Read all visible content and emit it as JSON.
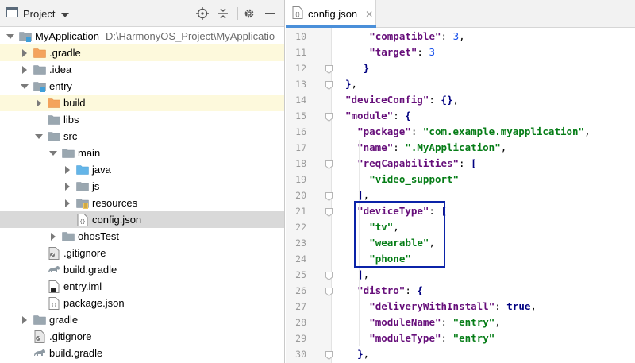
{
  "project_panel": {
    "title": "Project",
    "header_icons": [
      "locate-icon",
      "collapse-icon",
      "gear-icon",
      "hide-icon"
    ],
    "tree": [
      {
        "label": "MyApplication",
        "path": "D:\\HarmonyOS_Project\\MyApplicatio",
        "depth": 0,
        "arrow": "down",
        "icon": "module-folder"
      },
      {
        "label": ".gradle",
        "depth": 1,
        "arrow": "right",
        "icon": "folder-orange",
        "highlight": true
      },
      {
        "label": ".idea",
        "depth": 1,
        "arrow": "right",
        "icon": "folder-gray"
      },
      {
        "label": "entry",
        "depth": 1,
        "arrow": "down",
        "icon": "module-folder"
      },
      {
        "label": "build",
        "depth": 2,
        "arrow": "right",
        "icon": "folder-orange",
        "highlight": true
      },
      {
        "label": "libs",
        "depth": 2,
        "arrow": "none",
        "icon": "folder-gray"
      },
      {
        "label": "src",
        "depth": 2,
        "arrow": "down",
        "icon": "folder-gray"
      },
      {
        "label": "main",
        "depth": 3,
        "arrow": "down",
        "icon": "folder-gray"
      },
      {
        "label": "java",
        "depth": 4,
        "arrow": "right",
        "icon": "folder-blue"
      },
      {
        "label": "js",
        "depth": 4,
        "arrow": "right",
        "icon": "folder-gray"
      },
      {
        "label": "resources",
        "depth": 4,
        "arrow": "right",
        "icon": "folder-resources"
      },
      {
        "label": "config.json",
        "depth": 4,
        "arrow": "none",
        "icon": "json-file",
        "selected": true
      },
      {
        "label": "ohosTest",
        "depth": 3,
        "arrow": "right",
        "icon": "folder-gray"
      },
      {
        "label": ".gitignore",
        "depth": 2,
        "arrow": "none",
        "icon": "gitignore-file"
      },
      {
        "label": "build.gradle",
        "depth": 2,
        "arrow": "none",
        "icon": "gradle-file"
      },
      {
        "label": "entry.iml",
        "depth": 2,
        "arrow": "none",
        "icon": "iml-file"
      },
      {
        "label": "package.json",
        "depth": 2,
        "arrow": "none",
        "icon": "json-file"
      },
      {
        "label": "gradle",
        "depth": 1,
        "arrow": "right",
        "icon": "folder-gray"
      },
      {
        "label": ".gitignore",
        "depth": 1,
        "arrow": "none",
        "icon": "gitignore-file"
      },
      {
        "label": "build.gradle",
        "depth": 1,
        "arrow": "none",
        "icon": "gradle-file"
      }
    ]
  },
  "editor": {
    "tab_label": "config.json",
    "lines": [
      {
        "num": "10",
        "indent": 4,
        "tokens": [
          [
            "k",
            "\"compatible\""
          ],
          [
            "p",
            ": "
          ],
          [
            "n",
            "3"
          ],
          [
            "p",
            ","
          ]
        ]
      },
      {
        "num": "11",
        "indent": 4,
        "tokens": [
          [
            "k",
            "\"target\""
          ],
          [
            "p",
            ": "
          ],
          [
            "n",
            "3"
          ]
        ]
      },
      {
        "num": "12",
        "indent": 3,
        "tokens": [
          [
            "b",
            "}"
          ]
        ]
      },
      {
        "num": "13",
        "indent": 0,
        "tokens": [
          [
            "b",
            "}"
          ],
          [
            "p",
            ","
          ]
        ]
      },
      {
        "num": "14",
        "indent": 0,
        "tokens": [
          [
            "k",
            "\"deviceConfig\""
          ],
          [
            "p",
            ": "
          ],
          [
            "b",
            "{}"
          ],
          [
            "p",
            ","
          ]
        ]
      },
      {
        "num": "15",
        "indent": 0,
        "tokens": [
          [
            "k",
            "\"module\""
          ],
          [
            "p",
            ": "
          ],
          [
            "b",
            "{"
          ]
        ]
      },
      {
        "num": "16",
        "indent": 2,
        "tokens": [
          [
            "k",
            "\"package\""
          ],
          [
            "p",
            ": "
          ],
          [
            "s",
            "\"com.example.myapplication\""
          ],
          [
            "p",
            ","
          ]
        ]
      },
      {
        "num": "17",
        "indent": 2,
        "tokens": [
          [
            "k",
            "\"name\""
          ],
          [
            "p",
            ": "
          ],
          [
            "s",
            "\".MyApplication\""
          ],
          [
            "p",
            ","
          ]
        ]
      },
      {
        "num": "18",
        "indent": 2,
        "tokens": [
          [
            "k",
            "\"reqCapabilities\""
          ],
          [
            "p",
            ": "
          ],
          [
            "b",
            "["
          ]
        ]
      },
      {
        "num": "19",
        "indent": 4,
        "tokens": [
          [
            "s",
            "\"video_support\""
          ]
        ]
      },
      {
        "num": "20",
        "indent": 2,
        "tokens": [
          [
            "b",
            "]"
          ],
          [
            "p",
            ","
          ]
        ]
      },
      {
        "num": "21",
        "indent": 2,
        "tokens": [
          [
            "k",
            "\"deviceType\""
          ],
          [
            "p",
            ": "
          ],
          [
            "b",
            "["
          ]
        ]
      },
      {
        "num": "22",
        "indent": 4,
        "tokens": [
          [
            "s",
            "\"tv\""
          ],
          [
            "p",
            ","
          ]
        ]
      },
      {
        "num": "23",
        "indent": 4,
        "tokens": [
          [
            "s",
            "\"wearable\""
          ],
          [
            "p",
            ","
          ]
        ]
      },
      {
        "num": "24",
        "indent": 4,
        "tokens": [
          [
            "s",
            "\"phone\""
          ]
        ]
      },
      {
        "num": "25",
        "indent": 2,
        "tokens": [
          [
            "b",
            "]"
          ],
          [
            "p",
            ","
          ]
        ]
      },
      {
        "num": "26",
        "indent": 2,
        "tokens": [
          [
            "k",
            "\"distro\""
          ],
          [
            "p",
            ": "
          ],
          [
            "b",
            "{"
          ]
        ]
      },
      {
        "num": "27",
        "indent": 4,
        "tokens": [
          [
            "k",
            "\"deliveryWithInstall\""
          ],
          [
            "p",
            ": "
          ],
          [
            "b",
            "true"
          ],
          [
            "p",
            ","
          ]
        ]
      },
      {
        "num": "28",
        "indent": 4,
        "tokens": [
          [
            "k",
            "\"moduleName\""
          ],
          [
            "p",
            ": "
          ],
          [
            "s",
            "\"entry\""
          ],
          [
            "p",
            ","
          ]
        ]
      },
      {
        "num": "29",
        "indent": 4,
        "tokens": [
          [
            "k",
            "\"moduleType\""
          ],
          [
            "p",
            ": "
          ],
          [
            "s",
            "\"entry\""
          ]
        ]
      },
      {
        "num": "30",
        "indent": 2,
        "tokens": [
          [
            "b",
            "}"
          ],
          [
            "p",
            ","
          ]
        ]
      }
    ],
    "fold_lines": [
      "12",
      "13",
      "15",
      "18",
      "20",
      "21",
      "25",
      "26",
      "30"
    ]
  }
}
